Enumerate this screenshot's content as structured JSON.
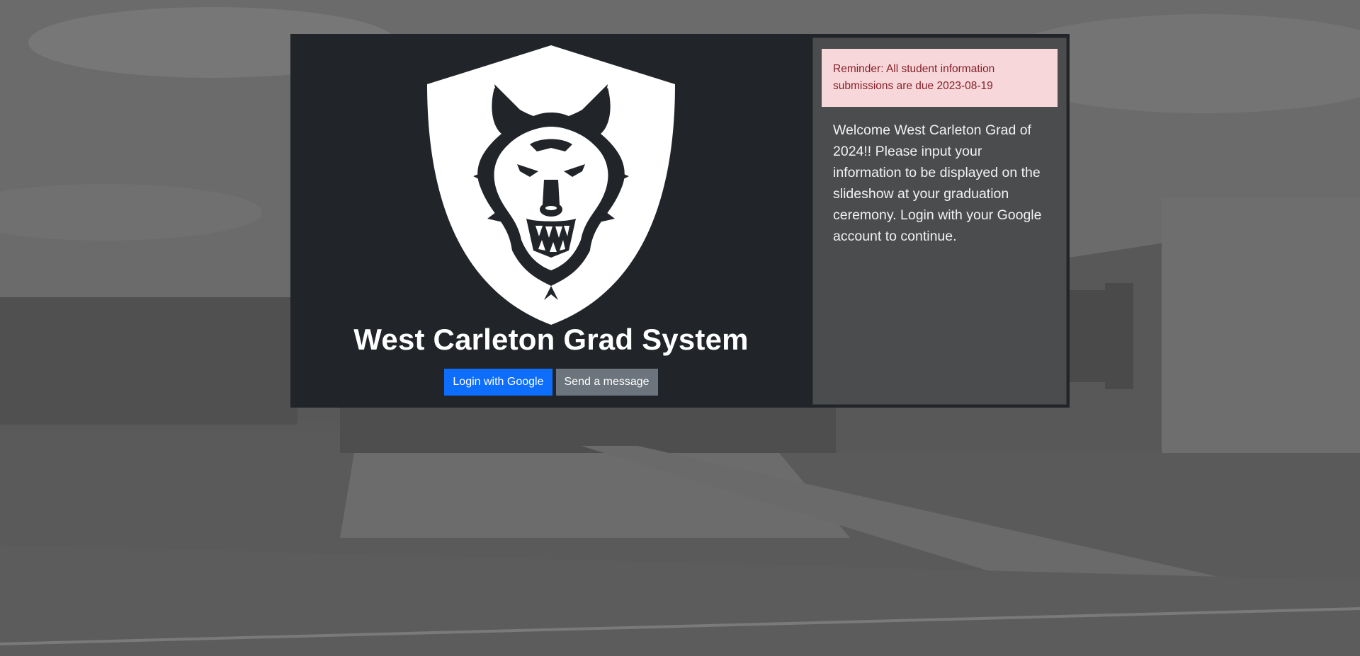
{
  "app": {
    "title": "West Carleton Grad System"
  },
  "actions": {
    "login_label": "Login with Google",
    "message_label": "Send a message"
  },
  "sidebar": {
    "alert_text": "Reminder: All student information submissions are due 2023-08-19",
    "welcome_text": "Welcome West Carleton Grad of 2024!! Please input your information to be displayed on the slideshow at your graduation ceremony. Login with your Google account to continue."
  },
  "colors": {
    "card_bg": "#212529",
    "primary": "#0d6efd",
    "secondary": "#6c757d",
    "alert_bg": "#f8d7da",
    "alert_text": "#842029"
  },
  "icons": {
    "crest": "wolf-crest-icon"
  }
}
